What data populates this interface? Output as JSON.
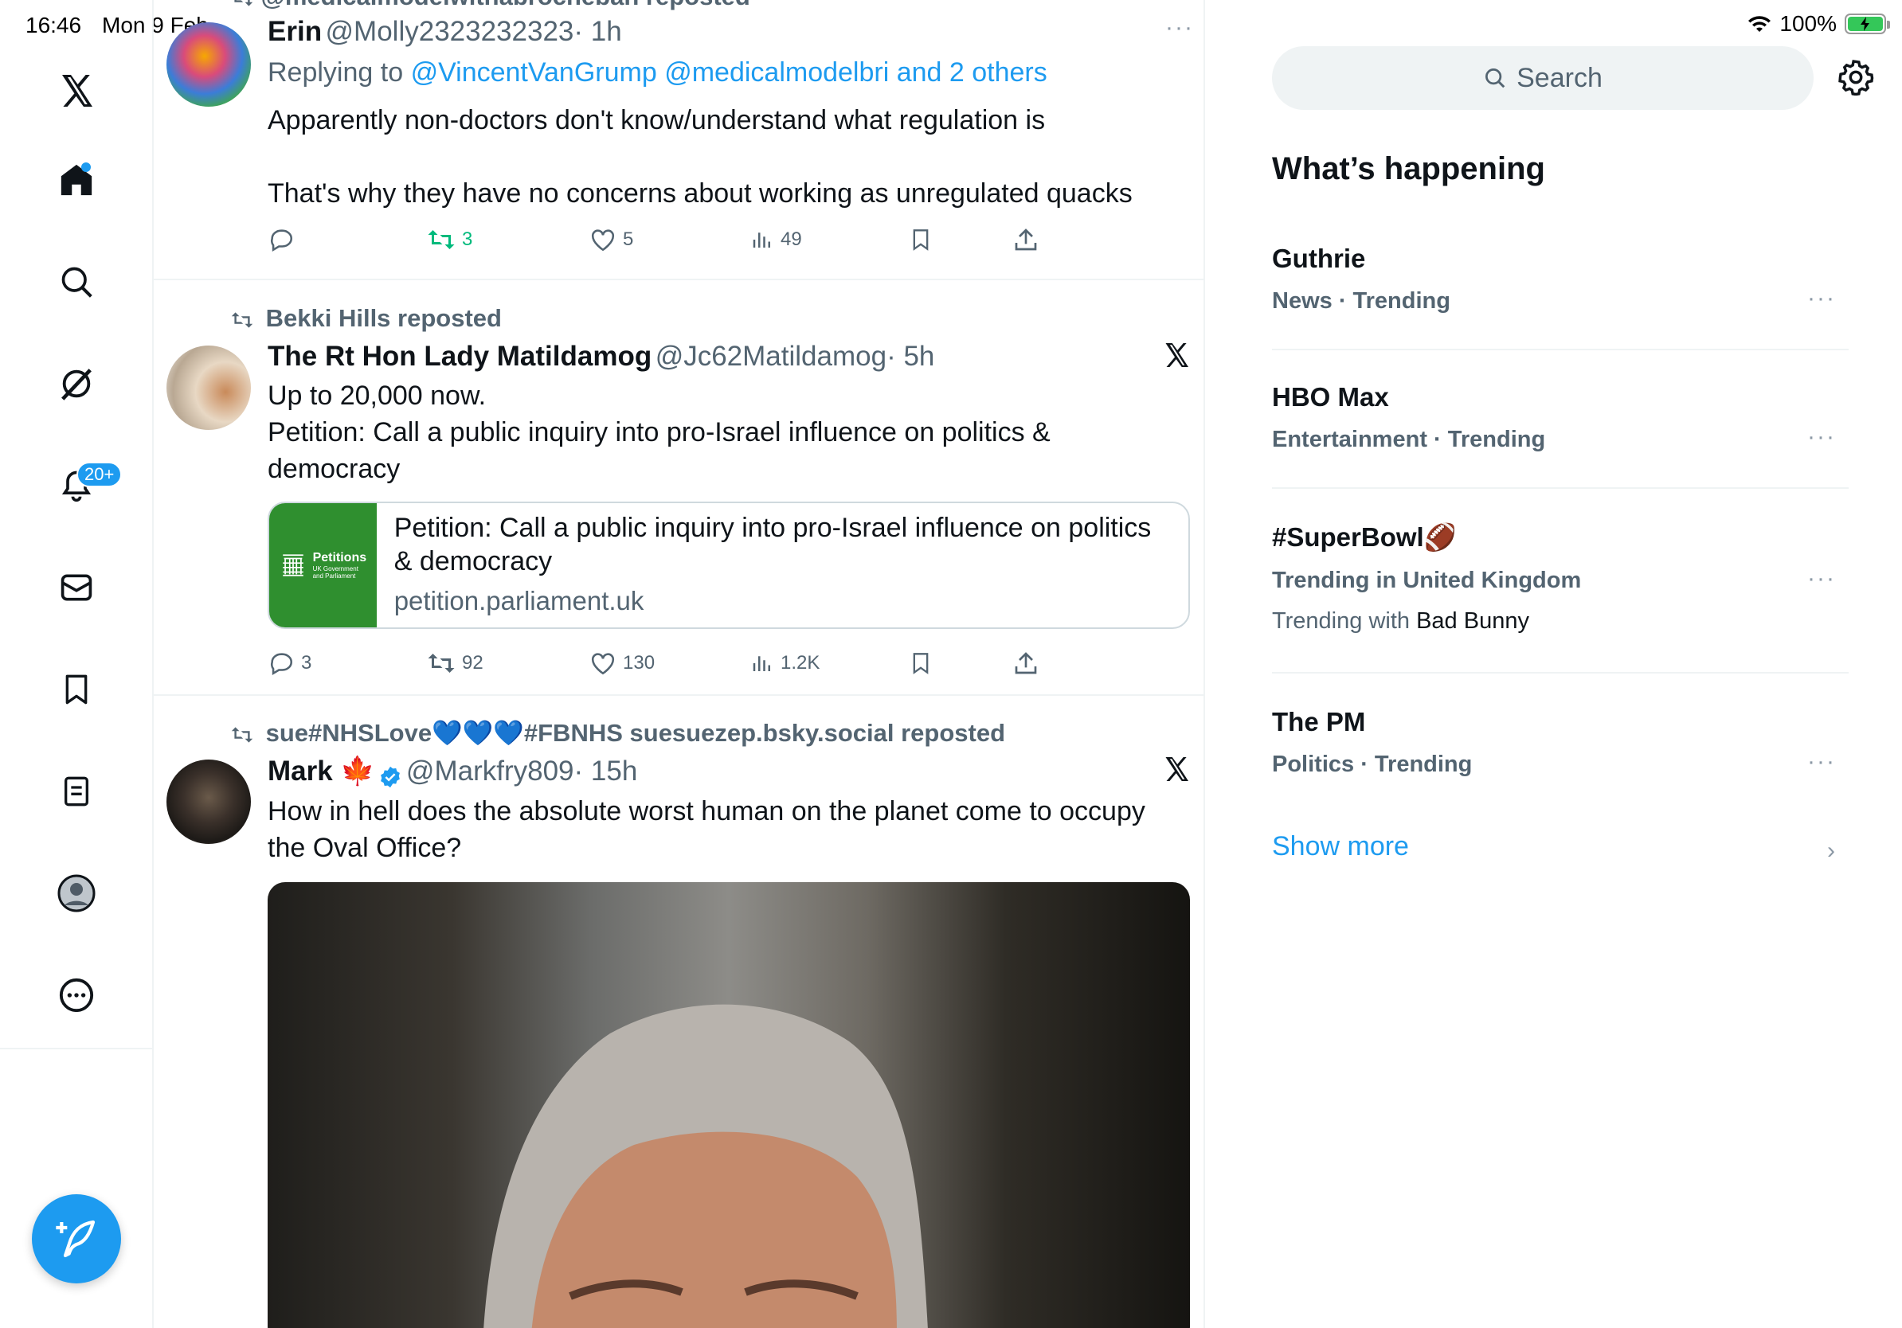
{
  "status_bar": {
    "time": "16:46",
    "date": "Mon 9 Feb",
    "battery": "100%"
  },
  "nav": {
    "notifications_badge": "20+",
    "items": [
      "x-logo-icon",
      "home-icon",
      "search-icon",
      "grok-icon",
      "bell-icon",
      "mail-icon",
      "bookmark-icon",
      "lists-icon",
      "profile-icon",
      "more-icon"
    ],
    "compose_icon": "feather-plus-icon"
  },
  "posts": [
    {
      "reposted_by": "@medicalmodelwithabrocheban reposted",
      "name": "Erin",
      "handle": "@Molly2323232323",
      "time": "· 1h",
      "replying_prefix": "Replying to",
      "replying_to": "@VincentVanGrump @medicalmodelbri and 2 others",
      "text_lines": [
        "Apparently non-doctors don't know/understand what regulation is",
        "That's why they have no concerns about working as unregulated quacks"
      ],
      "stats": {
        "replies": "",
        "reposts": "3",
        "likes": "5",
        "views": "49"
      }
    },
    {
      "reposted_by": "Bekki Hills reposted",
      "name": "The Rt Hon Lady Matildamog",
      "handle": "@Jc62Matildamog",
      "time": "· 5h",
      "text_lines": [
        "Up to 20,000 now.",
        "Petition: Call a public inquiry into pro-Israel influence on politics &",
        "democracy"
      ],
      "card": {
        "thumb_title": "Petitions",
        "thumb_sub": "UK Government and Parliament",
        "title": "Petition: Call a public inquiry into pro-Israel influence on politics & democracy",
        "domain": "petition.parliament.uk"
      },
      "stats": {
        "replies": "3",
        "reposts": "92",
        "likes": "130",
        "views": "1.2K"
      }
    },
    {
      "reposted_by": "sue#NHSLove💙💙💙#FBNHS suesuezep.bsky.social reposted",
      "name": "Mark 🍁",
      "handle": "@Markfry809",
      "time": "· 15h",
      "text_lines": [
        "How in hell does the absolute worst human on the planet come to occupy",
        "the Oval Office?"
      ]
    }
  ],
  "sidebar": {
    "search_placeholder": "Search",
    "section_title": "What’s happening",
    "trends": [
      {
        "name": "Guthrie",
        "meta": "News · Trending"
      },
      {
        "name": "HBO Max",
        "meta": "Entertainment · Trending"
      },
      {
        "name": "#SuperBowl🏈",
        "meta": "Trending in United Kingdom",
        "with_prefix": "Trending with",
        "with_name": "Bad Bunny"
      },
      {
        "name": "The PM",
        "meta": "Politics · Trending"
      }
    ],
    "show_more": "Show more"
  },
  "colors": {
    "accent": "#1d9bf0",
    "repost_green": "#00ba7c",
    "text_primary": "#0f1419",
    "text_secondary": "#536471"
  }
}
